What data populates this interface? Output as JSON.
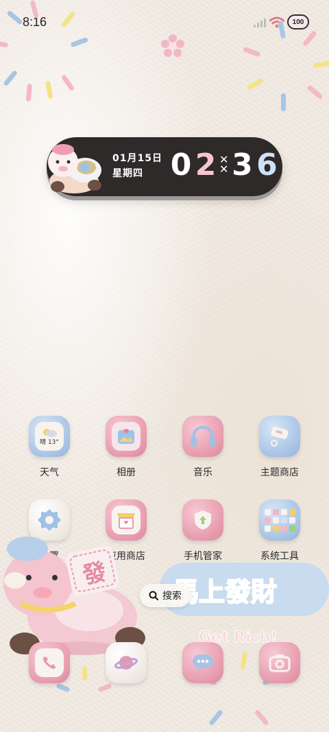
{
  "status_bar": {
    "time": "8:16",
    "battery": "100"
  },
  "clock_widget": {
    "date": "01月15日",
    "weekday": "星期四",
    "hour": [
      "0",
      "2"
    ],
    "minute": [
      "3",
      "6"
    ]
  },
  "apps": [
    {
      "label": "天气",
      "badge": "晴 13°"
    },
    {
      "label": "相册"
    },
    {
      "label": "音乐"
    },
    {
      "label": "主题商店"
    },
    {
      "label": "设置"
    },
    {
      "label": "应用商店"
    },
    {
      "label": "手机管家"
    },
    {
      "label": "系统工具"
    }
  ],
  "wallpaper": {
    "banner_title": "馬上發財",
    "banner_sub": "Get Rich!",
    "pony_tag": "發"
  },
  "search": {
    "label": "搜索"
  },
  "dock": [
    "phone-icon",
    "browser-icon",
    "messages-icon",
    "camera-icon"
  ],
  "colors": {
    "pink": "#e79bad",
    "blue": "#a8c3e4",
    "widget_bg": "#2e2a2a"
  }
}
